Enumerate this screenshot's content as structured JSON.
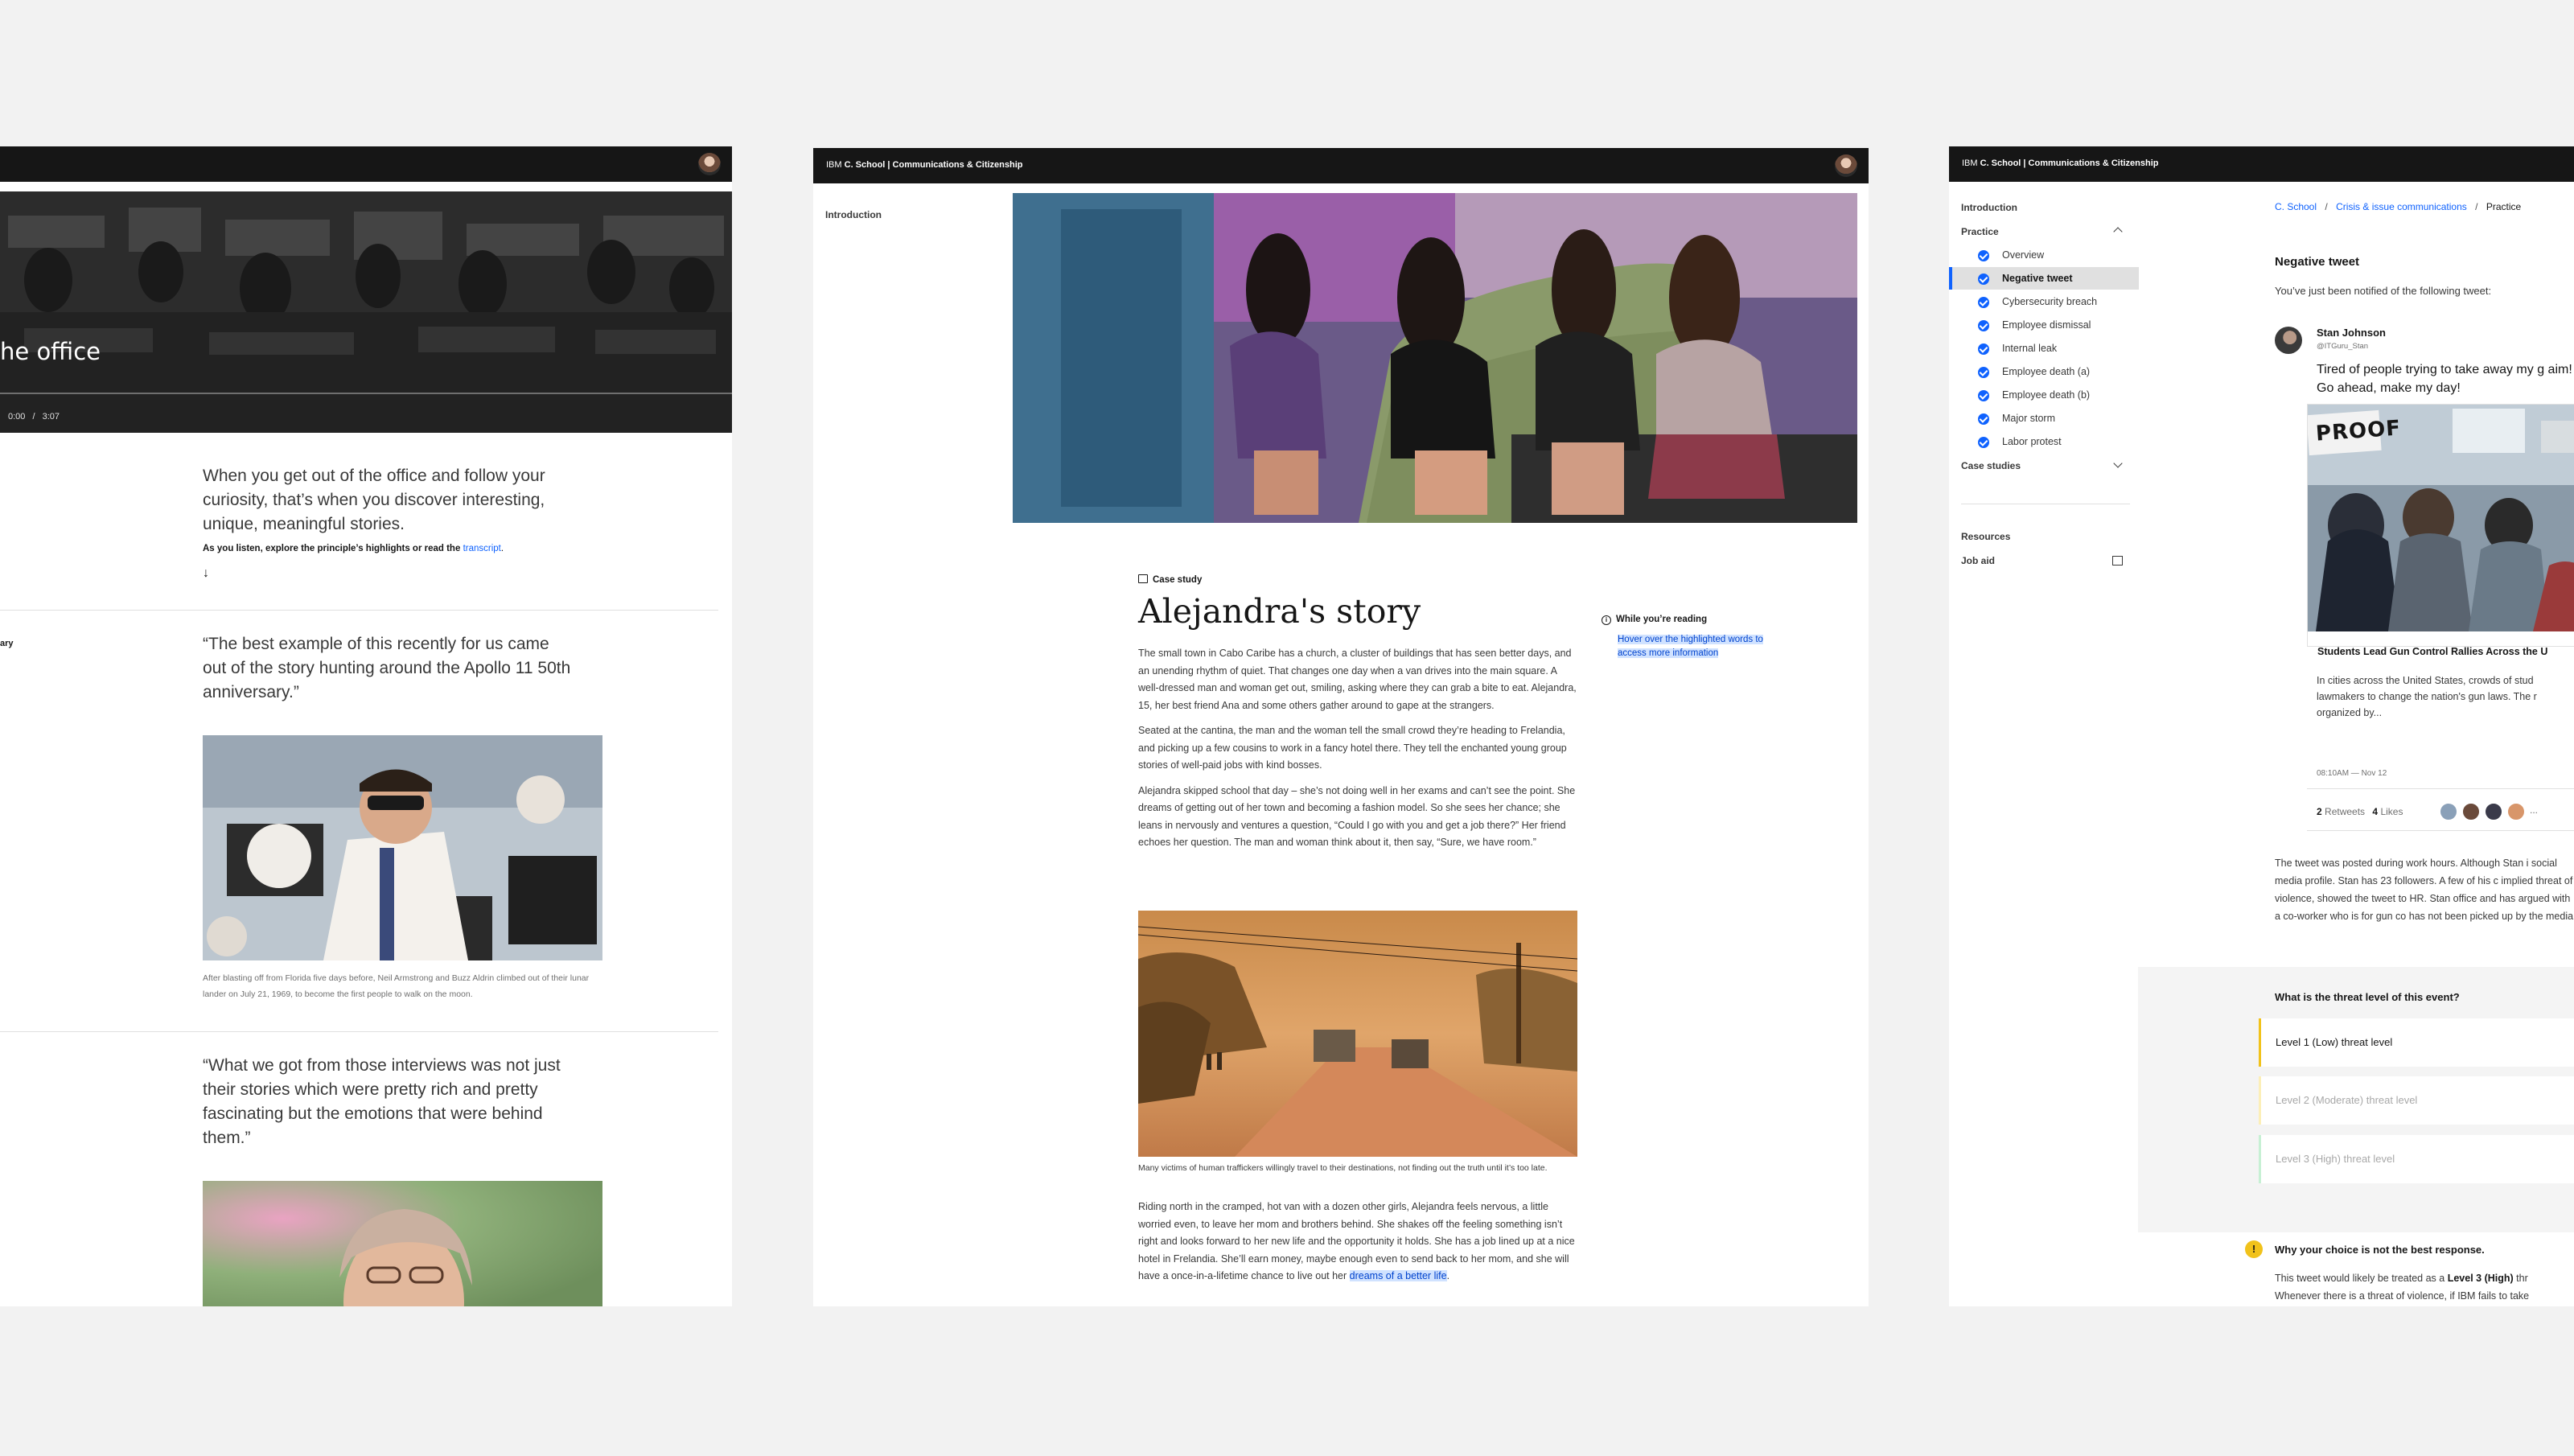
{
  "panel_left": {
    "video": {
      "title": "he office",
      "time_current": "0:00",
      "time_sep": "/",
      "time_total": "3:07"
    },
    "intro_quote": "When you get out of the office and follow your curiosity, that’s when you discover interesting, unique, meaningful stories.",
    "listen_prefix": "As you listen, explore the principle’s highlights or read the",
    "transcript_link": "transcript",
    "listen_suffix": ".",
    "down_arrow": "↓",
    "side_label": "ary",
    "quote_1": "“The best example of this recently for us came out of the story hunting around the Apollo 11 50th anniversary.”",
    "caption_1": "After blasting off from Florida five days before, Neil Armstrong and Buzz Aldrin climbed out of their lunar lander on July 21, 1969, to become the first people to walk on the moon.",
    "quote_2": "“What we got from those interviews was not just their stories which were pretty rich and pretty fascinating but the emotions that were behind them.”"
  },
  "panel_middle": {
    "header": {
      "brand_prefix": "IBM",
      "brand_rest": "C. School | Communications & Citizenship"
    },
    "sidebar_intro": "Introduction",
    "tag": "Case study",
    "title": "Alejandra's story",
    "paragraphs": [
      "The small town in Cabo Caribe has a church, a cluster of buildings that has seen better days, and an unending rhythm of quiet. That changes one day when a van drives into the main square. A well-dressed man and woman get out, smiling, asking where they can grab a bite to eat. Alejandra, 15, her best friend Ana and some others gather around to gape at the strangers.",
      "Seated at the cantina, the man and the woman tell the small crowd they’re heading to Frelandia, and picking up a few cousins to work in a fancy hotel there. They tell the enchanted young group stories of well-paid jobs with kind bosses.",
      "Alejandra skipped school that day – she’s not doing well in her exams and can’t see the point. She dreams of getting out of her town and becoming a fashion model. So she sees her chance; she leans in nervously and ventures a question, “Could I go with you and get a job there?” Her friend echoes her question. The man and woman think about it, then say, “Sure, we have room.”"
    ],
    "image_caption": "Many victims of human traffickers willingly travel to their destinations, not finding out the truth until it’s too late.",
    "last_paragraph_pre": "Riding north in the cramped, hot van with a dozen other girls, Alejandra feels nervous, a little worried even, to leave her mom and brothers behind. She shakes off the feeling something isn’t right and looks forward to her new life and the opportunity it holds. She has a job lined up at a nice hotel in Frelandia. She’ll earn money, maybe enough even to send back to her mom, and she will have a once-in-a-lifetime chance to live out her",
    "last_paragraph_hl": "dreams of a better life",
    "last_paragraph_post": ".",
    "aside": {
      "title": "While you’re reading",
      "note": "Hover over the highlighted words to access more information"
    }
  },
  "panel_right": {
    "header": {
      "brand_prefix": "IBM",
      "brand_rest": "C. School | Communications & Citizenship"
    },
    "nav": {
      "introduction": "Introduction",
      "practice": "Practice",
      "items": [
        "Overview",
        "Negative tweet",
        "Cybersecurity breach",
        "Employee dismissal",
        "Internal leak",
        "Employee death (a)",
        "Employee death (b)",
        "Major storm",
        "Labor protest"
      ],
      "case_studies": "Case studies",
      "resources": "Resources",
      "job_aid": "Job aid"
    },
    "breadcrumb": [
      "C. School",
      "Crisis & issue communications",
      "Practice"
    ],
    "breadcrumb_sep": "/",
    "heading": "Negative tweet",
    "intro": "You’ve just been notified of the following tweet:",
    "tweet": {
      "name": "Stan Johnson",
      "handle": "@ITGuru_Stan",
      "text": "Tired of people trying to take away my g aim! Go ahead, make my day!",
      "card_title": "Students Lead Gun Control Rallies Across the U",
      "card_desc": "In cities across the United States, crowds of stud lawmakers to change the nation's gun laws. The r organized by...",
      "sign_text": "PROOF",
      "time": "08:10AM — Nov 12",
      "retweets_count": "2",
      "retweets_label": "Retweets",
      "likes_count": "4",
      "likes_label": "Likes",
      "more": "..."
    },
    "description": "The tweet was posted during work hours. Although Stan i social media profile. Stan has 23 followers. A few of his c implied threat of violence, showed the tweet to HR. Stan office and has argued with a co-worker who is for gun co has not been picked up by the media.",
    "question": "What is the threat level of this event?",
    "options": [
      "Level 1 (Low) threat level",
      "Level 2 (Moderate) threat level",
      "Level 3 (High) threat level"
    ],
    "colors": {
      "option_1": "#f1c21b",
      "option_2": "#f1c21b",
      "option_3": "#42be65",
      "accent": "#0f62fe"
    },
    "feedback": {
      "icon": "!",
      "title": "Why your choice is not the best response.",
      "text_pre": "This tweet would likely be treated as a",
      "text_bold": "Level 3 (High)",
      "text_post": "thr",
      "text_line2": "Whenever there is a threat of violence, if IBM fails to take"
    }
  }
}
